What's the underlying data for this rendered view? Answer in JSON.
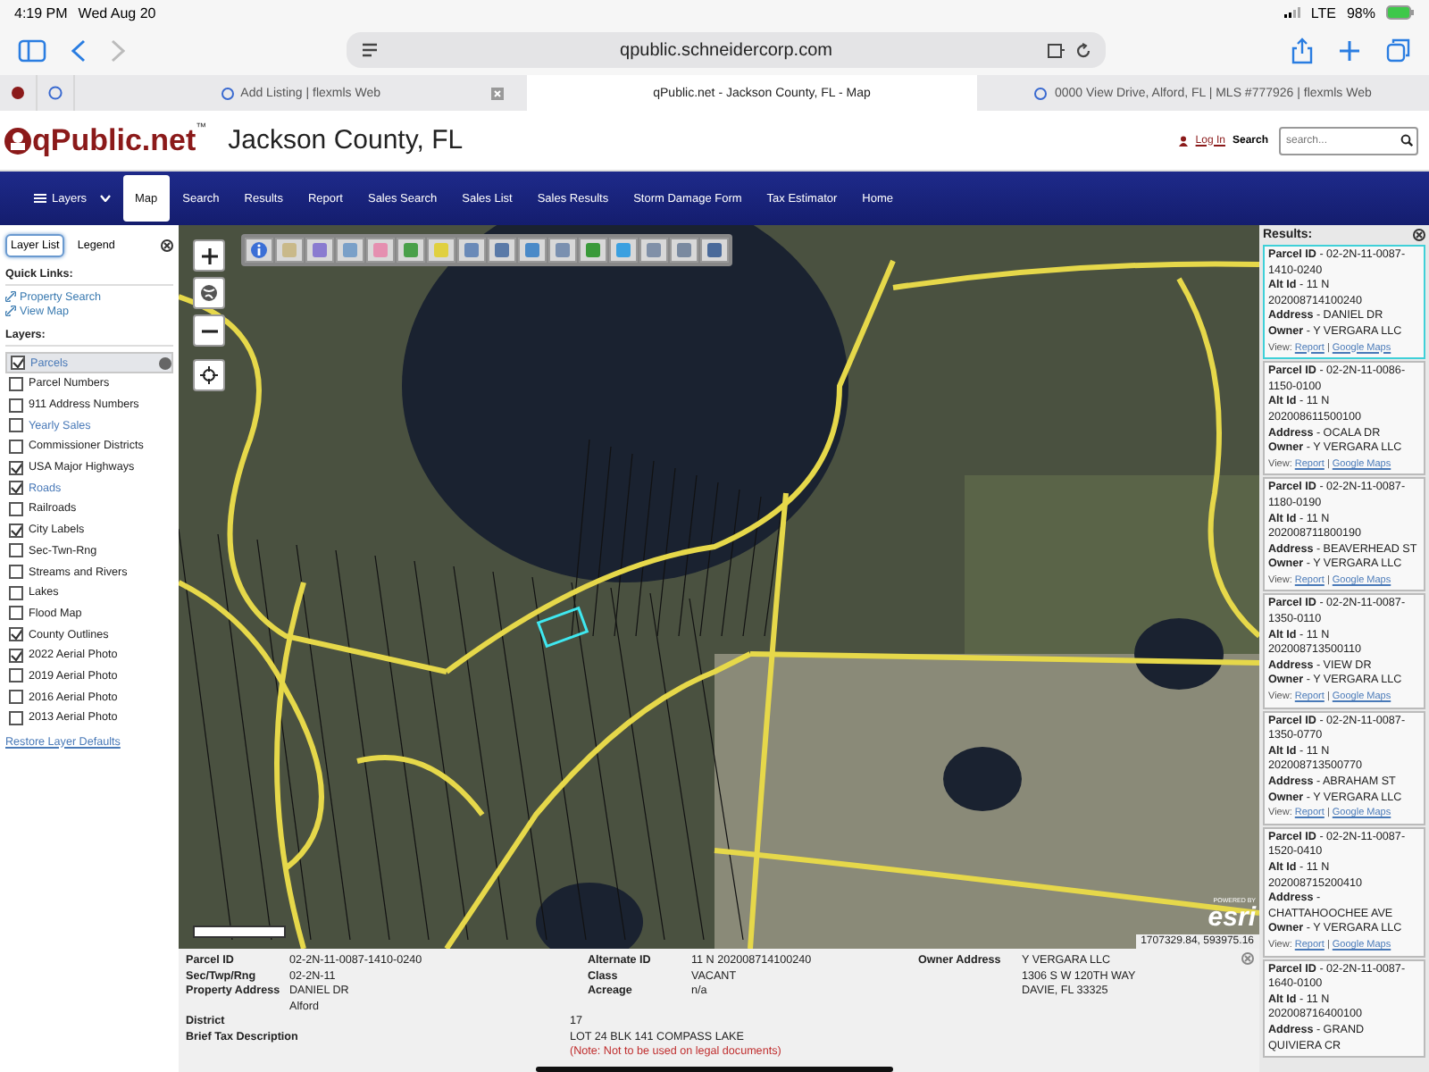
{
  "status_bar": {
    "time": "4:19 PM",
    "date": "Wed Aug 20",
    "network": "LTE",
    "battery": "98%"
  },
  "browser": {
    "url": "qpublic.schneidercorp.com",
    "tabs": [
      {
        "title": "Add Listing | flexmls Web",
        "selected": false
      },
      {
        "title": "qPublic.net - Jackson County, FL - Map",
        "selected": true
      },
      {
        "title": "0000 View Drive, Alford, FL | MLS #777926 | flexmls Web",
        "selected": false
      }
    ]
  },
  "header": {
    "logo": "qPublic.net",
    "trademark": "™",
    "county": "Jackson County, FL",
    "login": "Log In",
    "search_label": "Search",
    "search_placeholder": "search..."
  },
  "nav": [
    {
      "label": "Layers",
      "selected": false
    },
    {
      "label": "Map",
      "selected": true
    },
    {
      "label": "Search",
      "selected": false
    },
    {
      "label": "Results",
      "selected": false
    },
    {
      "label": "Report",
      "selected": false
    },
    {
      "label": "Sales Search",
      "selected": false
    },
    {
      "label": "Sales List",
      "selected": false
    },
    {
      "label": "Sales Results",
      "selected": false
    },
    {
      "label": "Storm Damage Form",
      "selected": false
    },
    {
      "label": "Tax Estimator",
      "selected": false
    },
    {
      "label": "Home",
      "selected": false
    }
  ],
  "sidebar": {
    "tabs": [
      {
        "label": "Layer List",
        "selected": true
      },
      {
        "label": "Legend",
        "selected": false
      }
    ],
    "quick_links_title": "Quick Links:",
    "quick_links": [
      "Property Search",
      "View Map"
    ],
    "layers_title": "Layers:",
    "layers": [
      {
        "label": "Parcels",
        "checked": true,
        "link": true,
        "selected": true
      },
      {
        "label": "Parcel Numbers",
        "checked": false,
        "link": false,
        "selected": false
      },
      {
        "label": "911 Address Numbers",
        "checked": false,
        "link": false,
        "selected": false
      },
      {
        "label": "Yearly Sales",
        "checked": false,
        "link": true,
        "selected": false
      },
      {
        "label": "Commissioner Districts",
        "checked": false,
        "link": false,
        "selected": false
      },
      {
        "label": "USA Major Highways",
        "checked": true,
        "link": false,
        "selected": false
      },
      {
        "label": "Roads",
        "checked": true,
        "link": true,
        "selected": false
      },
      {
        "label": "Railroads",
        "checked": false,
        "link": false,
        "selected": false
      },
      {
        "label": "City Labels",
        "checked": true,
        "link": false,
        "selected": false
      },
      {
        "label": "Sec-Twn-Rng",
        "checked": false,
        "link": false,
        "selected": false
      },
      {
        "label": "Streams and Rivers",
        "checked": false,
        "link": false,
        "selected": false
      },
      {
        "label": "Lakes",
        "checked": false,
        "link": false,
        "selected": false
      },
      {
        "label": "Flood Map",
        "checked": false,
        "link": false,
        "selected": false
      },
      {
        "label": "County Outlines",
        "checked": true,
        "link": false,
        "selected": false
      },
      {
        "label": "2022 Aerial Photo",
        "checked": true,
        "link": false,
        "selected": false
      },
      {
        "label": "2019 Aerial Photo",
        "checked": false,
        "link": false,
        "selected": false
      },
      {
        "label": "2016 Aerial Photo",
        "checked": false,
        "link": false,
        "selected": false
      },
      {
        "label": "2013 Aerial Photo",
        "checked": false,
        "link": false,
        "selected": false
      }
    ],
    "restore_link": "Restore Layer Defaults"
  },
  "map": {
    "coordinates": "1707329.84, 593975.16",
    "esri_powered": "POWERED BY",
    "esri": "esri"
  },
  "property_info": {
    "columns": [
      [
        {
          "label": "Parcel ID",
          "value": [
            "02-2N-11-0087-1410-0240"
          ]
        },
        {
          "label": "Sec/Twp/Rng",
          "value": [
            "02-2N-11"
          ]
        },
        {
          "label": "Property Address",
          "value": [
            "DANIEL DR",
            "Alford"
          ]
        }
      ],
      [
        {
          "label": "Alternate ID",
          "value": [
            "11 N 202008714100240"
          ]
        },
        {
          "label": "Class",
          "value": [
            "VACANT"
          ]
        },
        {
          "label": "Acreage",
          "value": [
            "n/a"
          ]
        }
      ],
      [
        {
          "label": "Owner Address",
          "value": [
            "Y VERGARA LLC",
            "1306 S W 120TH WAY",
            "DAVIE, FL 33325"
          ]
        }
      ]
    ],
    "wide": [
      {
        "label": "District",
        "value": "17"
      },
      {
        "label": "Brief Tax Description",
        "value": "LOT 24 BLK 141 COMPASS LAKE"
      }
    ],
    "note": "(Note: Not to be used on legal documents)"
  },
  "results": {
    "title": "Results:",
    "items": [
      {
        "selected": true,
        "lines": [
          "**Parcel ID** - 02-2N-11-0087-1410-0240",
          "**Alt Id** - 11 N",
          "202008714100240",
          "**Address** - DANIEL DR",
          "**Owner** - Y VERGARA LLC"
        ],
        "view": "View:",
        "links": [
          "Report",
          "Google Maps"
        ],
        "separator": "|"
      },
      {
        "selected": false,
        "lines": [
          "**Parcel ID** - 02-2N-11-0086-1150-0100",
          "**Alt Id** - 11 N",
          "202008611500100",
          "**Address** - OCALA DR",
          "**Owner** - Y VERGARA LLC"
        ],
        "view": "View:",
        "links": [
          "Report",
          "Google Maps"
        ],
        "separator": "|"
      },
      {
        "selected": false,
        "lines": [
          "**Parcel ID** - 02-2N-11-0087-1180-0190",
          "**Alt Id** - 11 N",
          "202008711800190",
          "**Address** - BEAVERHEAD ST",
          "**Owner** - Y VERGARA LLC"
        ],
        "view": "View:",
        "links": [
          "Report",
          "Google Maps"
        ],
        "separator": "|"
      },
      {
        "selected": false,
        "lines": [
          "**Parcel ID** - 02-2N-11-0087-1350-0110",
          "**Alt Id** - 11 N",
          "202008713500110",
          "**Address** - VIEW DR",
          "**Owner** - Y VERGARA LLC"
        ],
        "view": "View:",
        "links": [
          "Report",
          "Google Maps"
        ],
        "separator": "|"
      },
      {
        "selected": false,
        "lines": [
          "**Parcel ID** - 02-2N-11-0087-1350-0770",
          "**Alt Id** - 11 N",
          "202008713500770",
          "**Address** - ABRAHAM ST",
          "**Owner** - Y VERGARA LLC"
        ],
        "view": "View:",
        "links": [
          "Report",
          "Google Maps"
        ],
        "separator": "|"
      },
      {
        "selected": false,
        "lines": [
          "**Parcel ID** - 02-2N-11-0087-1520-0410",
          "**Alt Id** - 11 N",
          "202008715200410",
          "**Address** - CHATTAHOOCHEE AVE",
          "**Owner** - Y VERGARA LLC"
        ],
        "view": "View:",
        "links": [
          "Report",
          "Google Maps"
        ],
        "separator": "|"
      },
      {
        "selected": false,
        "lines": [
          "**Parcel ID** - 02-2N-11-0087-1640-0100",
          "**Alt Id** - 11 N",
          "202008716400100",
          "**Address** - GRAND QUIVIERA CR"
        ]
      }
    ]
  }
}
